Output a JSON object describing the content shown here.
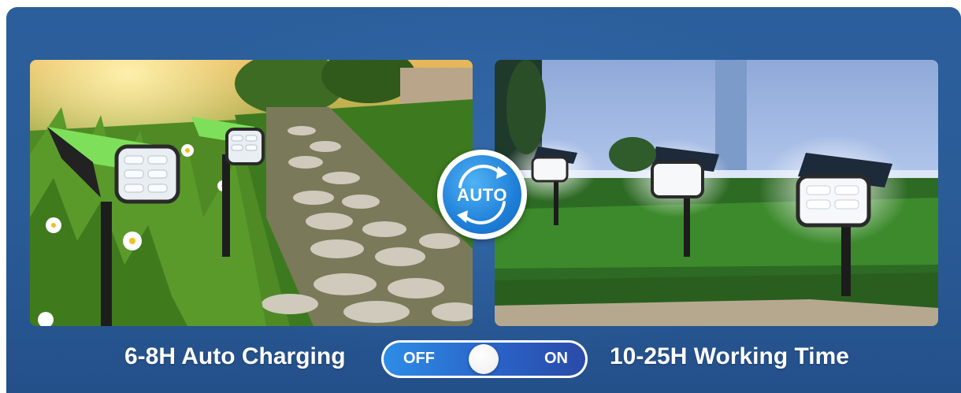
{
  "badge": {
    "text": "AUTO",
    "icon": "refresh-arrows-icon"
  },
  "captions": {
    "left": "6-8H Auto Charging",
    "right": "10-25H Working Time"
  },
  "toggle": {
    "off_label": "OFF",
    "on_label": "ON",
    "state": "off"
  },
  "colors": {
    "banner_bg": "#2b5f9c",
    "badge_blue": "#1f7fd8",
    "toggle_blue": "#2a63c8",
    "text": "#ffffff"
  },
  "images": {
    "left": "daytime-garden-solar-lights-photo",
    "right": "nighttime-lit-solar-spotlights-photo"
  }
}
